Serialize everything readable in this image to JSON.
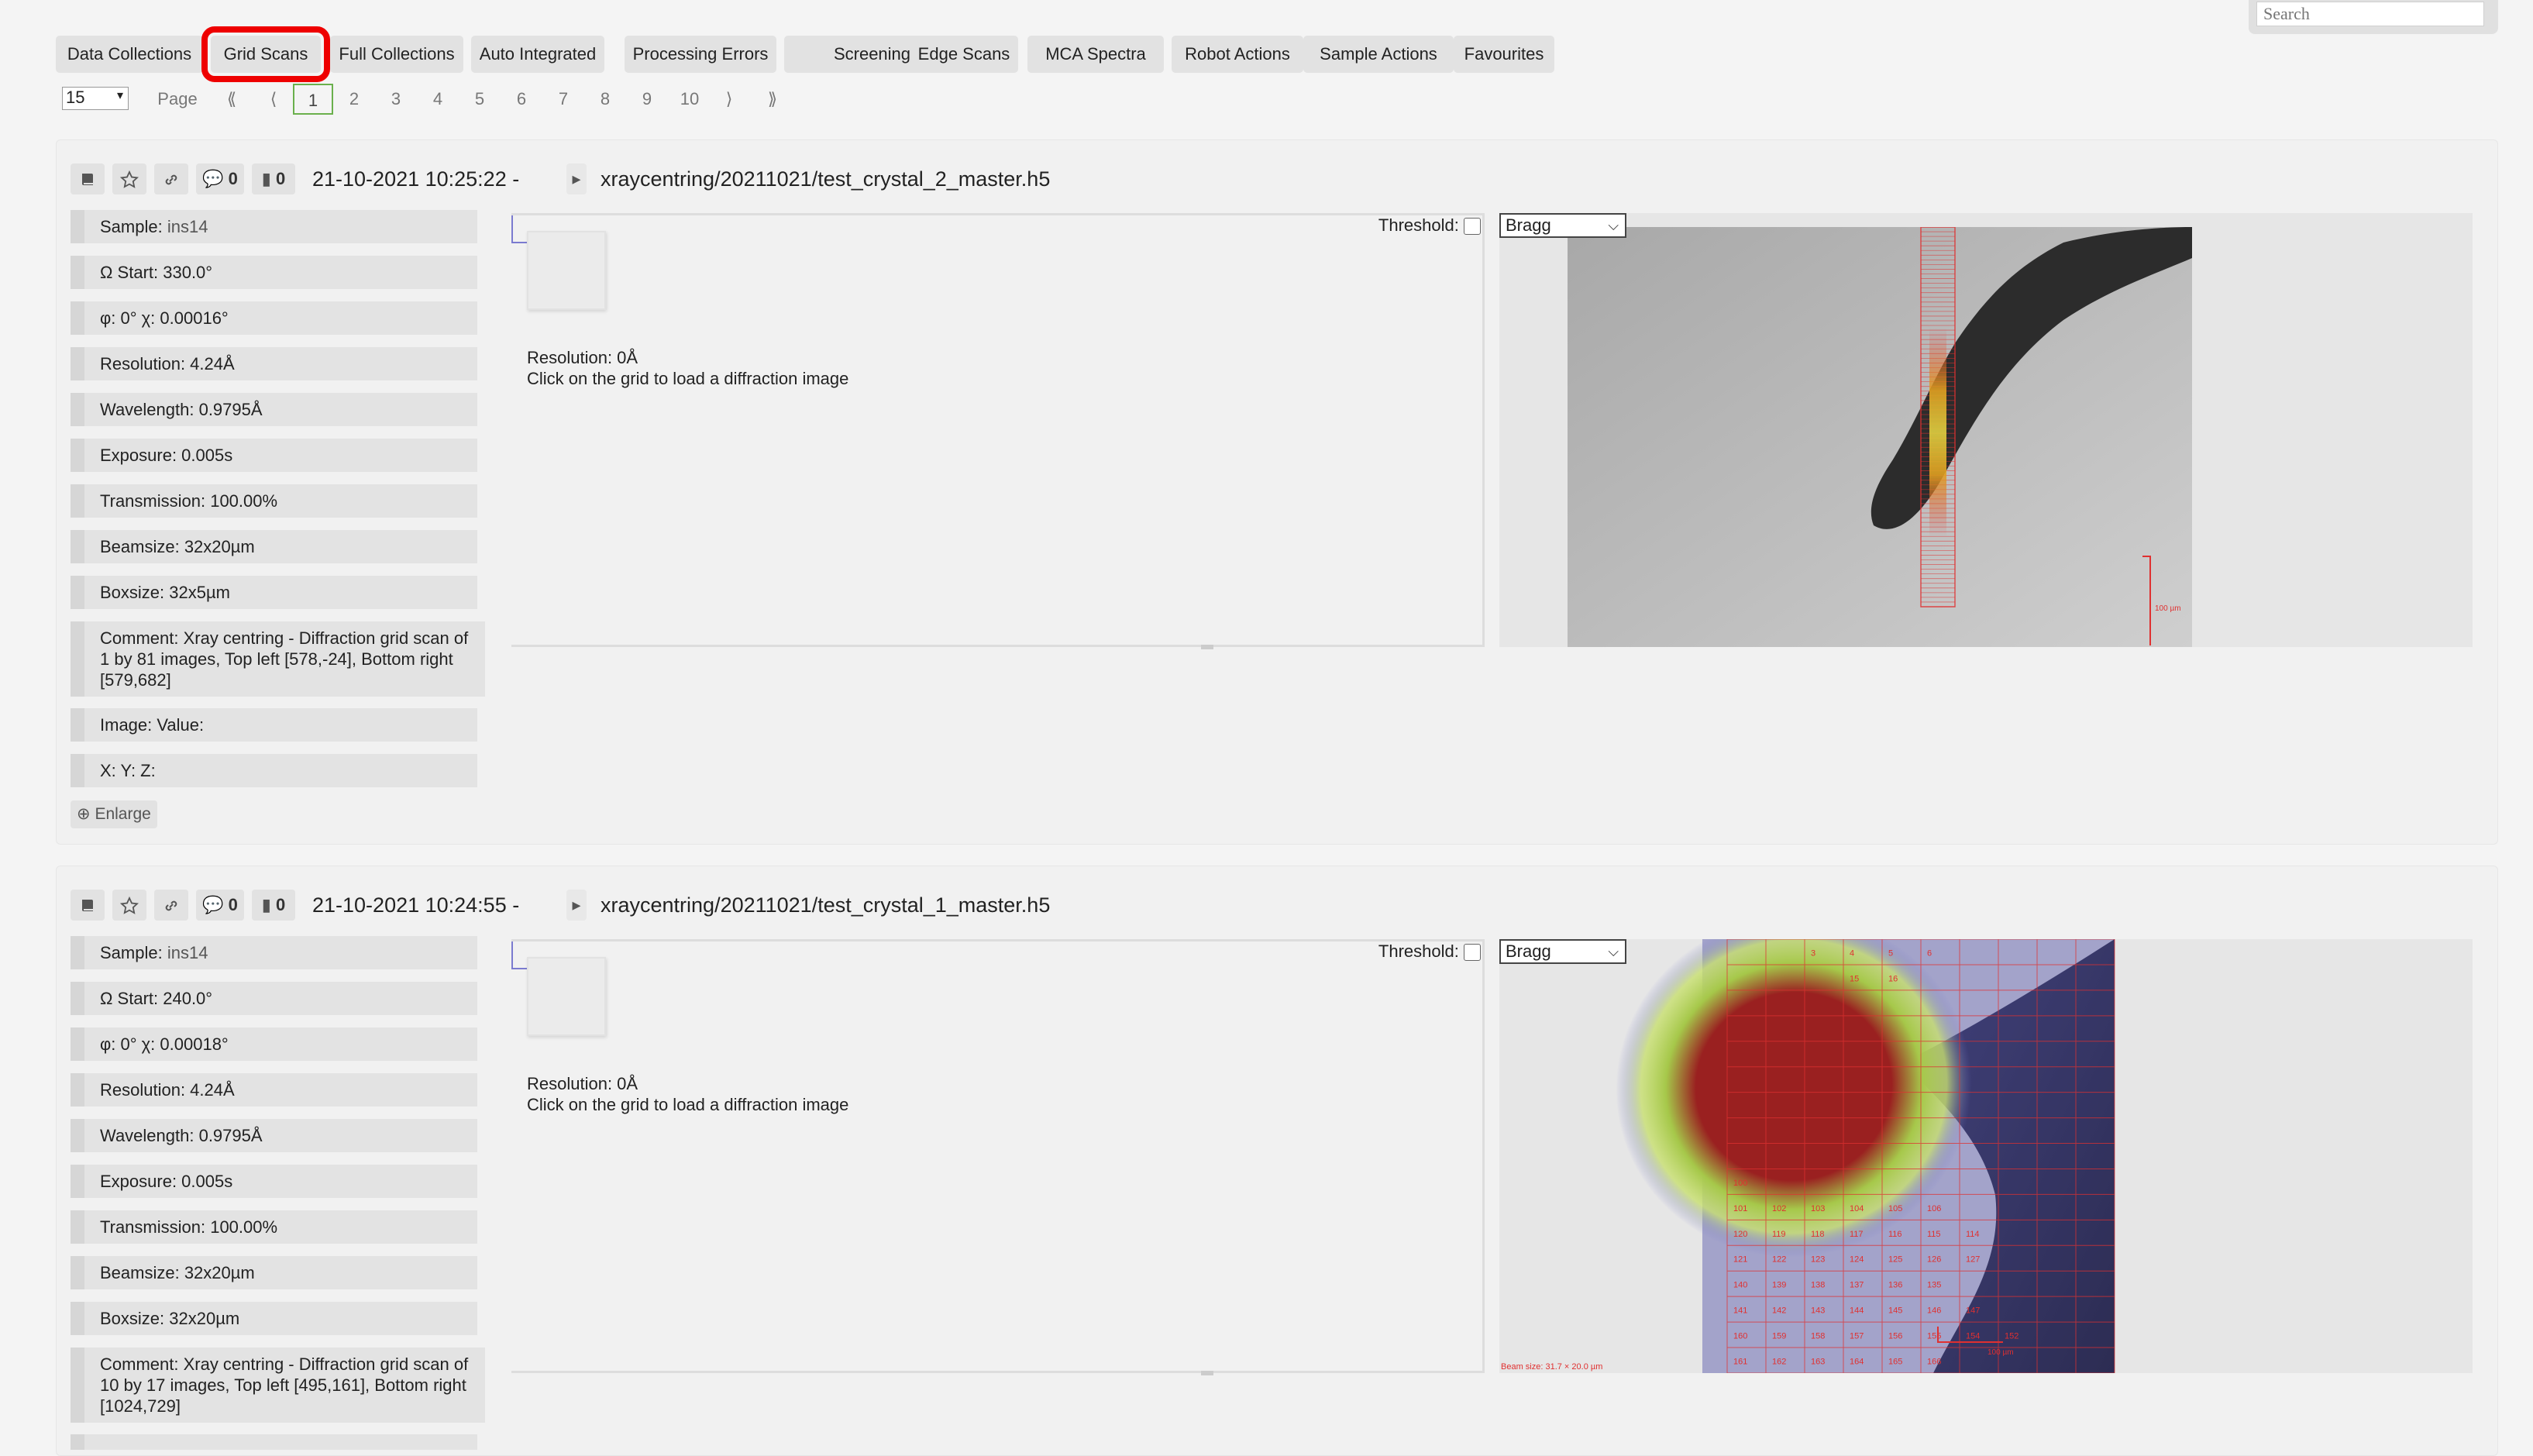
{
  "search": {
    "placeholder": "Search"
  },
  "tabs": [
    {
      "label": "Data Collections"
    },
    {
      "label": "Grid Scans"
    },
    {
      "label": "Full Collections"
    },
    {
      "label": "Auto Integrated"
    },
    {
      "label": "Processing Errors"
    },
    {
      "label": "Screenings"
    },
    {
      "label": "Edge Scans"
    },
    {
      "label": "MCA Spectra"
    },
    {
      "label": "Robot Actions"
    },
    {
      "label": "Sample Actions"
    },
    {
      "label": "Favourites"
    }
  ],
  "pagination": {
    "per_page": "15",
    "page_label": "Page",
    "first": "⟪",
    "prev": "⟨",
    "pages": [
      "1",
      "2",
      "3",
      "4",
      "5",
      "6",
      "7",
      "8",
      "9",
      "10"
    ],
    "next": "⟩",
    "last": "⟫",
    "current": "1"
  },
  "panels": [
    {
      "comments_count": "0",
      "files_count": "0",
      "datetime": "21-10-2021 10:25:22 -",
      "path": "xraycentring/20211021/test_crystal_2_master.h5",
      "sample_label": "Sample:",
      "sample_value": "ins14",
      "omega_start": "Ω Start: 330.0°",
      "phi_chi": "φ: 0° χ: 0.00016°",
      "resolution": "Resolution: 4.24Å",
      "wavelength": "Wavelength: 0.9795Å",
      "exposure": "Exposure: 0.005s",
      "transmission": "Transmission: 100.00%",
      "beamsize": "Beamsize: 32x20µm",
      "boxsize": "Boxsize: 32x5µm",
      "comment": "Comment: Xray centring - Diffraction grid scan of 1 by 81 images, Top left [578,-24], Bottom right [579,682]",
      "image_value": "Image: Value:",
      "xyz": "X: Y: Z:",
      "enlarge": "Enlarge",
      "diff_resolution": "Resolution: 0Å",
      "diff_hint": "Click on the grid to load a diffraction image",
      "threshold_label": "Threshold:",
      "view_mode": "Bragg",
      "scale_label": "100 µm"
    },
    {
      "comments_count": "0",
      "files_count": "0",
      "datetime": "21-10-2021 10:24:55 -",
      "path": "xraycentring/20211021/test_crystal_1_master.h5",
      "sample_label": "Sample:",
      "sample_value": "ins14",
      "omega_start": "Ω Start: 240.0°",
      "phi_chi": "φ: 0° χ: 0.00018°",
      "resolution": "Resolution: 4.24Å",
      "wavelength": "Wavelength: 0.9795Å",
      "exposure": "Exposure: 0.005s",
      "transmission": "Transmission: 100.00%",
      "beamsize": "Beamsize: 32x20µm",
      "boxsize": "Boxsize: 32x20µm",
      "comment": "Comment: Xray centring - Diffraction grid scan of 10 by 17 images, Top left [495,161], Bottom right [1024,729]",
      "diff_resolution": "Resolution: 0Å",
      "diff_hint": "Click on the grid to load a diffraction image",
      "threshold_label": "Threshold:",
      "view_mode": "Bragg",
      "beam_size_caption": "Beam size: 31.7 × 20.0 µm",
      "scale_label": "100 µm",
      "grid_numbers": {
        "row0": [
          "3",
          "4",
          "5",
          "6"
        ],
        "row1": [
          "15",
          "16"
        ],
        "row6": [
          "100"
        ],
        "row7": [
          "101",
          "102",
          "103",
          "104",
          "105",
          "106"
        ],
        "row8": [
          "120",
          "119",
          "118",
          "117",
          "116",
          "115",
          "114"
        ],
        "row9": [
          "121",
          "122",
          "123",
          "124",
          "125",
          "126",
          "127"
        ],
        "row10": [
          "140",
          "139",
          "138",
          "137",
          "136",
          "135"
        ],
        "row11": [
          "141",
          "142",
          "143",
          "144",
          "145",
          "146",
          "147"
        ],
        "row12": [
          "160",
          "159",
          "158",
          "157",
          "156",
          "155",
          "154",
          "152"
        ],
        "row13": [
          "161",
          "162",
          "163",
          "164",
          "165",
          "166"
        ]
      }
    }
  ],
  "colors": {
    "active_outline": "#ee0000",
    "current_page": "#6ab04c",
    "grid_red": "#e03030",
    "corner_blue": "#7b7bd0"
  }
}
